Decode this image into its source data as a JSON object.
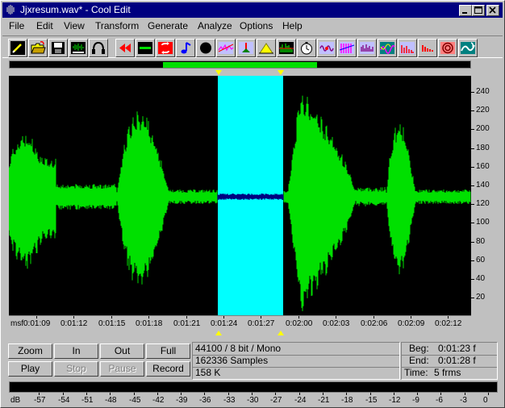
{
  "window": {
    "title": "Jjxresum.wav* - Cool Edit",
    "controls": [
      "minimize-icon",
      "maximize-icon",
      "close-icon"
    ]
  },
  "menu": {
    "items": [
      {
        "label": "File"
      },
      {
        "label": "Edit"
      },
      {
        "label": "View"
      },
      {
        "label": "Transform"
      },
      {
        "label": "Generate"
      },
      {
        "label": "Analyze"
      },
      {
        "label": "Options"
      },
      {
        "label": "Help"
      }
    ]
  },
  "toolbar": {
    "tools": [
      "new-file-icon",
      "open-folder-icon",
      "save-disk-icon",
      "cd-player-icon",
      "headphones-icon",
      "rewind-icon",
      "stop-square-icon",
      "loop-icon",
      "music-note-icon",
      "record-circle-icon",
      "noise-reduction-icon",
      "amplify-icon",
      "envelope-icon",
      "spectrum-bars-icon",
      "stopwatch-icon",
      "wave-generator-icon",
      "filter-icon",
      "graphic-eq-icon",
      "pitch-bend-icon",
      "reverb-icon",
      "delay-icon",
      "echo-icon"
    ]
  },
  "colors": {
    "waveform": "#00e000",
    "selection": "#00ffff",
    "selected_wave": "#000080",
    "background": "#000000",
    "marker": "#ffff00",
    "overview_view": "#00e000"
  },
  "waveform": {
    "y_ticks": [
      "240",
      "220",
      "200",
      "180",
      "160",
      "140",
      "120",
      "100",
      "80",
      "60",
      "40",
      "20"
    ],
    "time_ticks": [
      "0:01:09",
      "0:01:12",
      "0:01:15",
      "0:01:18",
      "0:01:21",
      "0:01:24",
      "0:01:27",
      "0:02:00",
      "0:02:03",
      "0:02:06",
      "0:02:09",
      "0:02:12"
    ],
    "time_unit": "msf",
    "overview_fraction": {
      "start": 0.333,
      "end": 0.668
    }
  },
  "transport": {
    "zoom": "Zoom",
    "in": "In",
    "out": "Out",
    "full": "Full",
    "play": "Play",
    "stop": "Stop",
    "pause": "Pause",
    "record": "Record"
  },
  "info": {
    "format": "44100 / 8 bit / Mono",
    "samples": "162336 Samples",
    "size": "158 K",
    "beg_label": "Beg:",
    "beg_value": "0:01:23 f",
    "end_label": "End:",
    "end_value": "0:01:28 f",
    "time_label": "Time:",
    "time_value": "5 frms"
  },
  "meter": {
    "labels": [
      "dB",
      "-57",
      "-54",
      "-51",
      "-48",
      "-45",
      "-42",
      "-39",
      "-36",
      "-33",
      "-30",
      "-27",
      "-24",
      "-21",
      "-18",
      "-15",
      "-12",
      "-9",
      "-6",
      "-3",
      "0"
    ]
  }
}
